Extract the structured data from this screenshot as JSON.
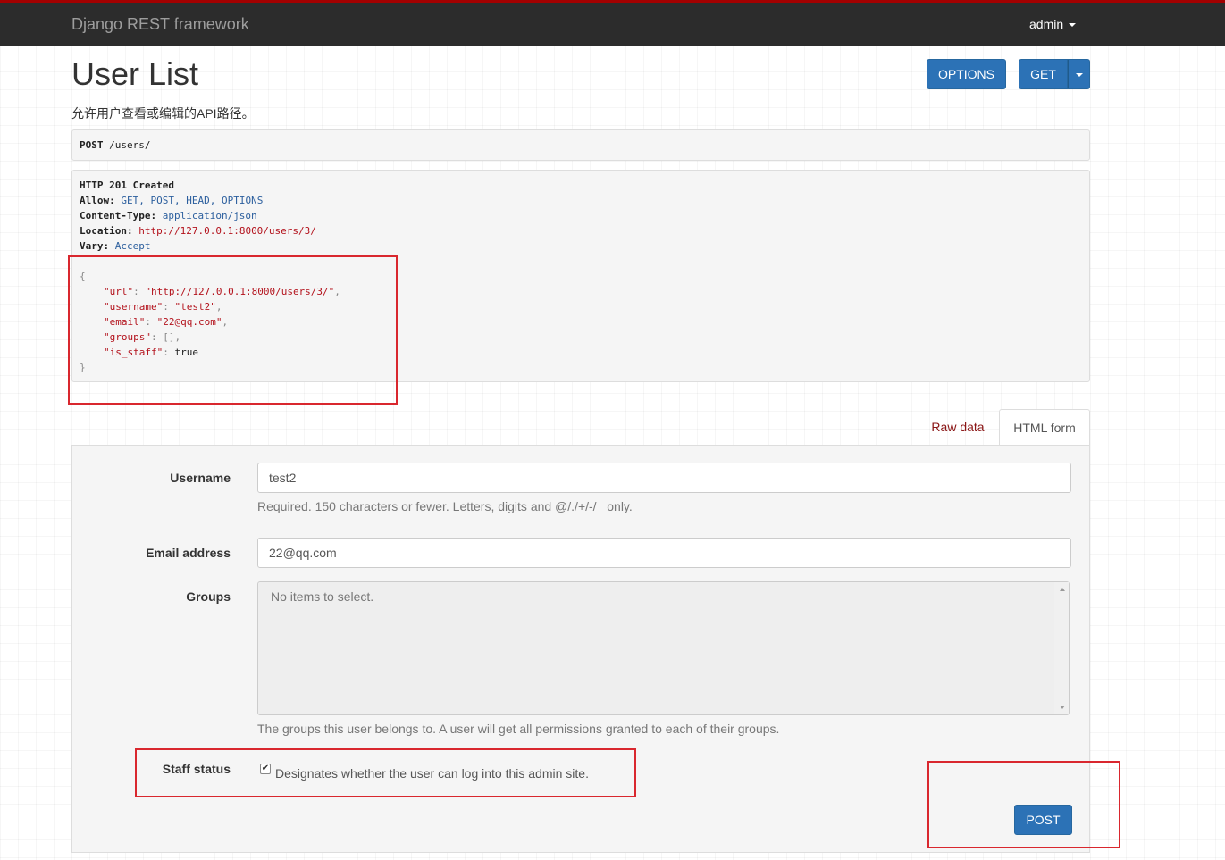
{
  "navbar": {
    "brand": "Django REST framework",
    "user": "admin"
  },
  "header": {
    "title": "User List",
    "description": "允许用户查看或编辑的API路径。",
    "options_button": "OPTIONS",
    "get_button": "GET"
  },
  "request": {
    "method": "POST",
    "path": "/users/"
  },
  "response": {
    "status": "HTTP 201 Created",
    "headers": {
      "allow_key": "Allow:",
      "allow_value": "GET, POST, HEAD, OPTIONS",
      "content_type_key": "Content-Type:",
      "content_type_value": "application/json",
      "location_key": "Location:",
      "location_value": "http://127.0.0.1:8000/users/3/",
      "vary_key": "Vary:",
      "vary_value": "Accept"
    },
    "body": {
      "open": "{",
      "url_key": "\"url\"",
      "url_value": "\"http://127.0.0.1:8000/users/3/\"",
      "username_key": "\"username\"",
      "username_value": "\"test2\"",
      "email_key": "\"email\"",
      "email_value": "\"22@qq.com\"",
      "groups_key": "\"groups\"",
      "groups_value": "[]",
      "is_staff_key": "\"is_staff\"",
      "is_staff_value": "true",
      "close": "}"
    }
  },
  "tabs": {
    "raw": "Raw data",
    "html": "HTML form"
  },
  "form": {
    "username_label": "Username",
    "username_value": "test2",
    "username_help": "Required. 150 characters or fewer. Letters, digits and @/./+/-/_ only.",
    "email_label": "Email address",
    "email_value": "22@qq.com",
    "groups_label": "Groups",
    "groups_empty": "No items to select.",
    "groups_help": "The groups this user belongs to. A user will get all permissions granted to each of their groups.",
    "staff_label": "Staff status",
    "staff_checked": true,
    "staff_help": "Designates whether the user can log into this admin site.",
    "submit": "POST"
  },
  "colors": {
    "navbar_bg": "#2c2c2c",
    "navbar_accent": "#a30000",
    "button_primary": "#2c72b6",
    "annotation": "#d9272e"
  }
}
